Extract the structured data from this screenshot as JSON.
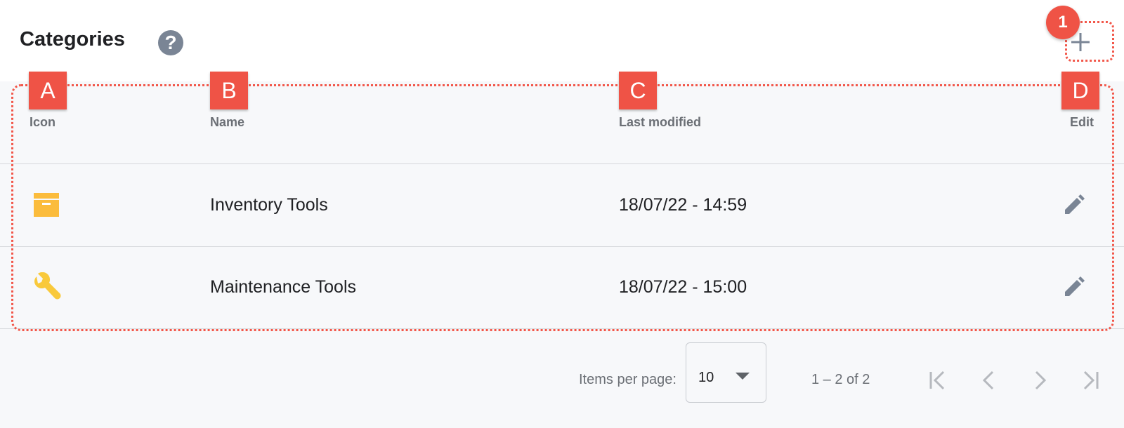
{
  "header": {
    "title": "Categories",
    "help_icon": "?",
    "add_icon": "plus-icon"
  },
  "annotations": {
    "badge_number": "1",
    "column_letters": [
      "A",
      "B",
      "C",
      "D"
    ],
    "color": "#ef5346"
  },
  "table": {
    "columns": [
      "Icon",
      "Name",
      "Last modified",
      "Edit"
    ],
    "rows": [
      {
        "icon": "archive-box-icon",
        "icon_color": "#fbbc3c",
        "name": "Inventory Tools",
        "last_modified": "18/07/22 - 14:59"
      },
      {
        "icon": "wrench-icon",
        "icon_color": "#f9c93b",
        "name": "Maintenance Tools",
        "last_modified": "18/07/22 - 15:00"
      }
    ]
  },
  "pagination": {
    "items_per_page_label": "Items per page:",
    "items_per_page_value": "10",
    "range_label": "1 – 2 of 2"
  },
  "colors": {
    "icon_gray": "#7a8595",
    "background": "#f7f8fa"
  }
}
